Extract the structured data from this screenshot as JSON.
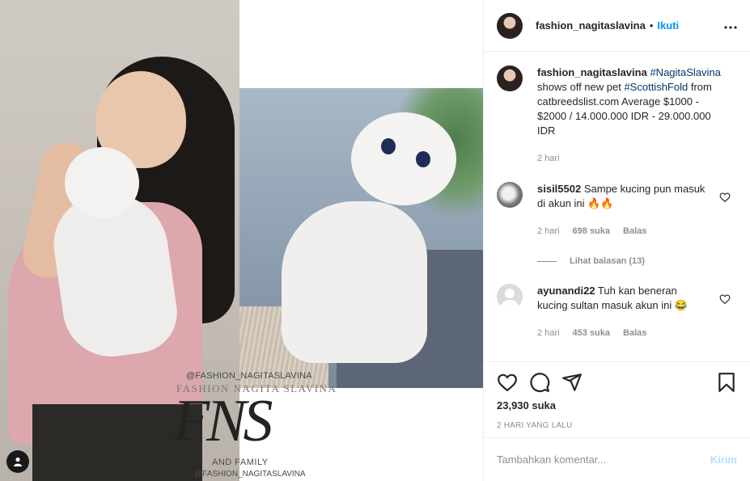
{
  "post": {
    "watermark": {
      "handle_top": "@FASHION_NAGITASLAVINA",
      "name": "FASHION NAGITA SLAVINA",
      "logo": "FNS",
      "family": "AND FAMILY",
      "handle_bottom": "@FASHION_NAGITASLAVINA"
    },
    "user_tag_icon": "user-icon"
  },
  "header": {
    "username": "fashion_nagitaslavina",
    "separator": "•",
    "follow_label": "Ikuti",
    "more_icon": "more-horizontal-icon"
  },
  "caption": {
    "username": "fashion_nagitaslavina",
    "hashtag1": "#NagitaSlavina",
    "text1": "shows off new pet",
    "hashtag2": "#ScottishFold",
    "text2": "from catbreedslist.com Average $1000 - $2000 / 14.000.000 IDR - 29.000.000 IDR",
    "time": "2 hari"
  },
  "comments": [
    {
      "username": "sisil5502",
      "text": "Sampe kucing pun masuk di akun ini 🔥🔥",
      "time": "2 hari",
      "likes": "698 suka",
      "reply_label": "Balas",
      "view_replies": "Lihat balasan (13)"
    },
    {
      "username": "ayunandi22",
      "text": "Tuh kan beneran kucing sultan masuk akun ini 😂",
      "time": "2 hari",
      "likes": "453 suka",
      "reply_label": "Balas"
    }
  ],
  "actions": {
    "likes_count": "23,930 suka",
    "timestamp": "2 HARI YANG LALU",
    "icons": [
      "heart-icon",
      "comment-icon",
      "share-icon",
      "bookmark-icon"
    ]
  },
  "add_comment": {
    "placeholder": "Tambahkan komentar...",
    "post_label": "Kirim"
  },
  "colors": {
    "link_blue": "#0095f6",
    "hashtag": "#00376b",
    "muted": "#8e8e8e",
    "post_disabled": "#b2dffc"
  }
}
